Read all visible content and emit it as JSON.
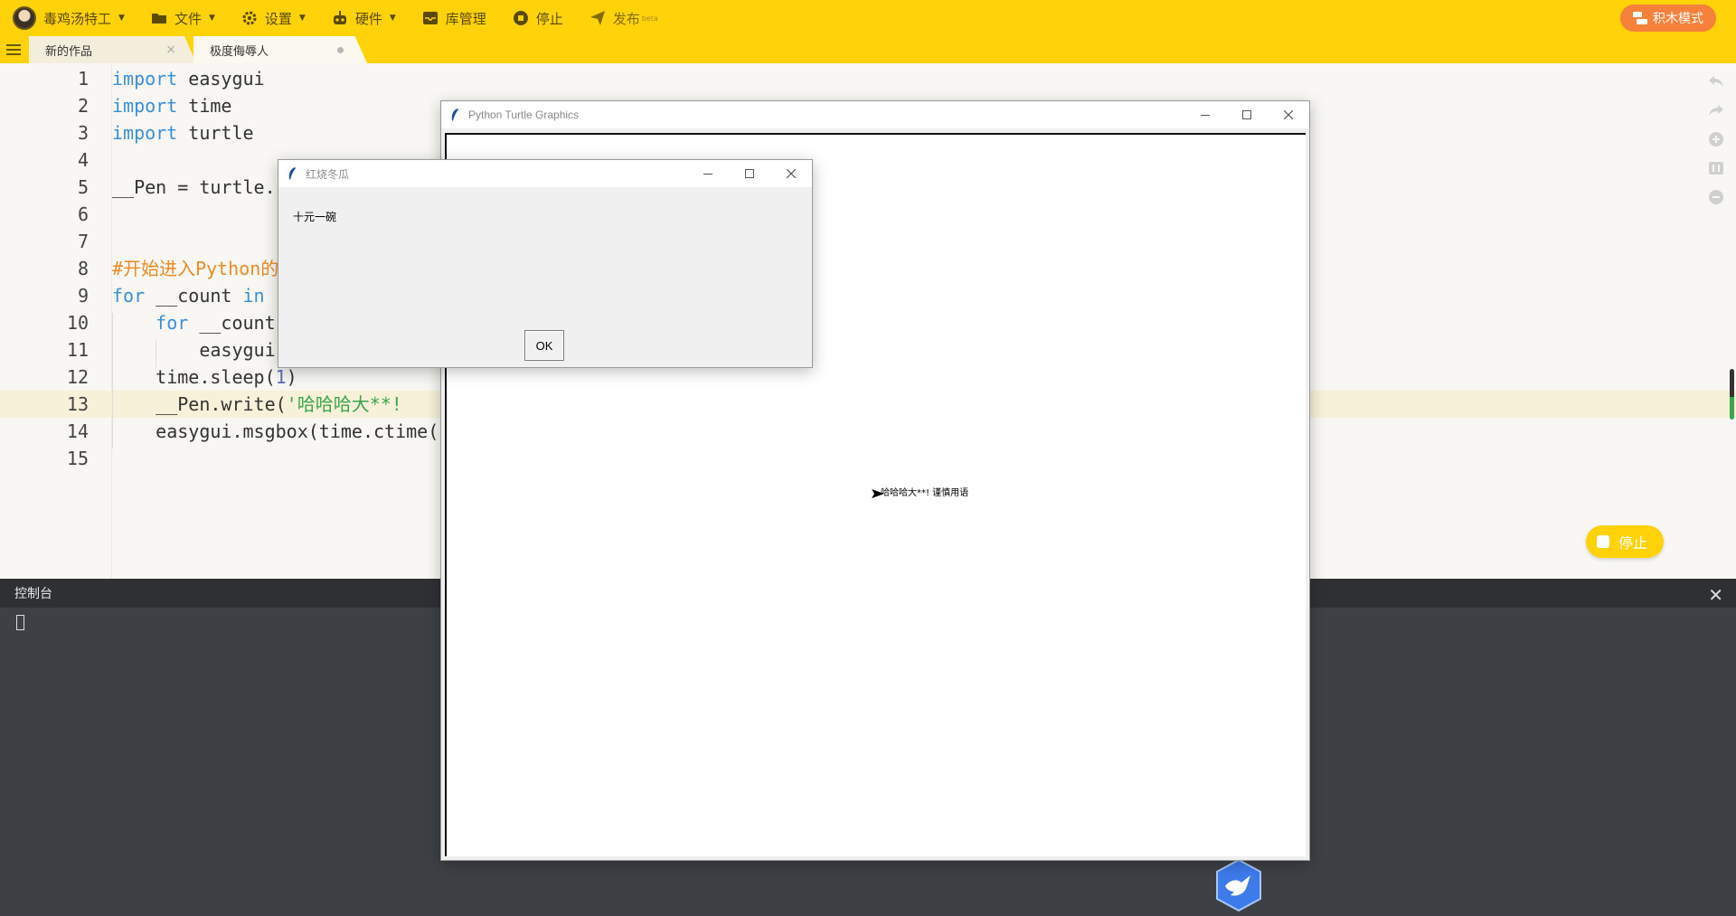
{
  "toolbar": {
    "user_name": "毒鸡汤特工",
    "file": "文件",
    "settings": "设置",
    "hardware": "硬件",
    "library": "库管理",
    "stop": "停止",
    "publish": "发布",
    "publish_badge": "beta",
    "mode_button": "积木模式"
  },
  "tabs": [
    {
      "label": "新的作品",
      "close": "×"
    },
    {
      "label": "极度侮辱人"
    }
  ],
  "editor": {
    "lines": [
      {
        "n": "1",
        "tokens": [
          {
            "t": "import",
            "c": "kw"
          },
          {
            "t": " easygui",
            "c": ""
          }
        ]
      },
      {
        "n": "2",
        "tokens": [
          {
            "t": "import",
            "c": "kw"
          },
          {
            "t": " time",
            "c": ""
          }
        ]
      },
      {
        "n": "3",
        "tokens": [
          {
            "t": "import",
            "c": "kw"
          },
          {
            "t": " turtle",
            "c": ""
          }
        ]
      },
      {
        "n": "4",
        "tokens": []
      },
      {
        "n": "5",
        "tokens": [
          {
            "t": "__Pen = turtle.",
            "c": ""
          }
        ]
      },
      {
        "n": "6",
        "tokens": []
      },
      {
        "n": "7",
        "tokens": []
      },
      {
        "n": "8",
        "tokens": [
          {
            "t": "#开始进入Python的",
            "c": "cm"
          }
        ]
      },
      {
        "n": "9",
        "tokens": [
          {
            "t": "for",
            "c": "kw"
          },
          {
            "t": " __count ",
            "c": ""
          },
          {
            "t": "in",
            "c": "kw"
          }
        ]
      },
      {
        "n": "10",
        "tokens": [
          {
            "t": "    ",
            "c": ""
          },
          {
            "t": "for",
            "c": "kw"
          },
          {
            "t": " __count",
            "c": ""
          }
        ]
      },
      {
        "n": "11",
        "tokens": [
          {
            "t": "        easygui",
            "c": ""
          }
        ]
      },
      {
        "n": "12",
        "tokens": [
          {
            "t": "    time.sleep(",
            "c": ""
          },
          {
            "t": "1",
            "c": "num"
          },
          {
            "t": ")",
            "c": ""
          }
        ]
      },
      {
        "n": "13",
        "tokens": [
          {
            "t": "    __Pen.write(",
            "c": ""
          },
          {
            "t": "'哈哈哈大**!",
            "c": "str"
          }
        ]
      },
      {
        "n": "14",
        "tokens": [
          {
            "t": "    easygui.msgbox(time.ctime(",
            "c": ""
          }
        ]
      },
      {
        "n": "15",
        "tokens": []
      }
    ]
  },
  "stop_float": "停止",
  "console": {
    "title": "控制台",
    "close": "✕"
  },
  "turtle_window": {
    "title": "Python Turtle Graphics",
    "canvas_text": "哈哈哈大**! 谨慎用语"
  },
  "msgbox": {
    "title": "红烧冬瓜",
    "message": "十元一碗",
    "ok": "OK"
  },
  "colors": {
    "brand": "#ffd20a",
    "mode_button": "#f5813a",
    "keyword": "#3a8fd8",
    "comment": "#f08a24",
    "string": "#3aa64b",
    "console_bg": "#3d4045"
  }
}
